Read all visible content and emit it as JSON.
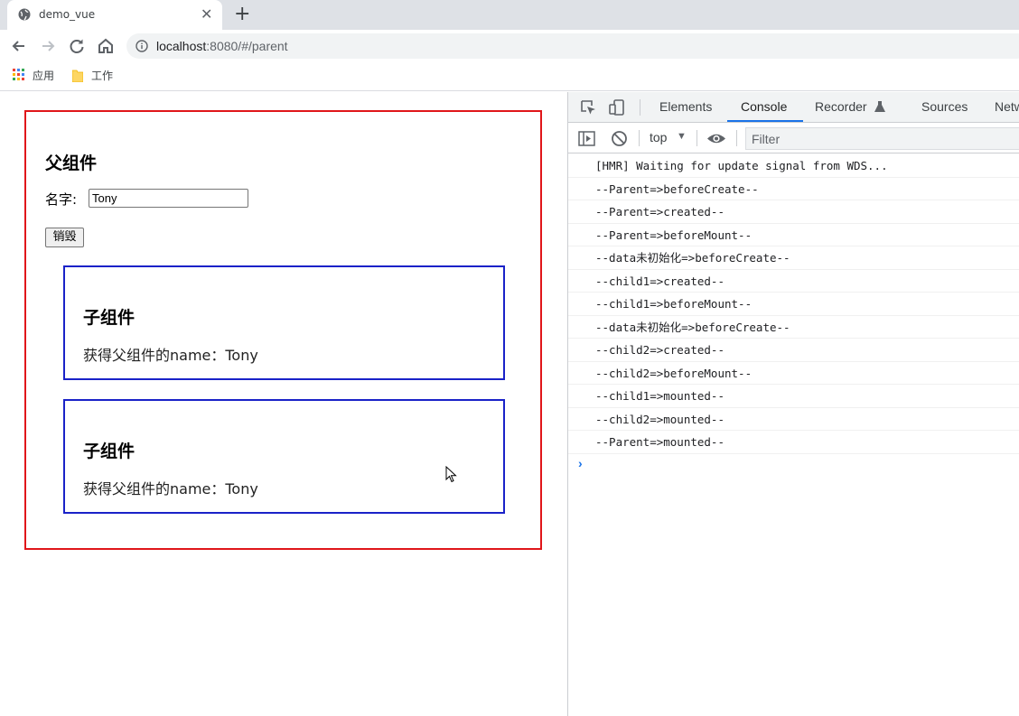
{
  "browser": {
    "tab_title": "demo_vue",
    "url_host": "localhost",
    "url_rest": ":8080/#/parent",
    "bookmarks": [
      {
        "label": "应用",
        "icon": "apps-grid-icon"
      },
      {
        "label": "工作",
        "icon": "folder-icon"
      }
    ]
  },
  "page": {
    "parent_title": "父组件",
    "name_label": "名字:",
    "name_value": "Tony",
    "destroy_button": "销毁",
    "children": [
      {
        "title": "子组件",
        "text": "获得父组件的name：Tony"
      },
      {
        "title": "子组件",
        "text": "获得父组件的name：Tony"
      }
    ]
  },
  "devtools": {
    "tabs": [
      "Elements",
      "Console",
      "Recorder",
      "Sources",
      "Netw"
    ],
    "active_tab": "Console",
    "context": "top",
    "filter_placeholder": "Filter",
    "console_logs": [
      "[HMR] Waiting for update signal from WDS...",
      "--Parent=>beforeCreate--",
      "--Parent=>created--",
      "--Parent=>beforeMount--",
      "--data未初始化=>beforeCreate--",
      "--child1=>created--",
      "--child1=>beforeMount--",
      "--data未初始化=>beforeCreate--",
      "--child2=>created--",
      "--child2=>beforeMount--",
      "--child1=>mounted--",
      "--child2=>mounted--",
      "--Parent=>mounted--"
    ],
    "prompt": "›"
  },
  "colors": {
    "parent_border": "#e0161a",
    "child_border": "#1a22c8",
    "devtools_accent": "#1a73e8"
  }
}
